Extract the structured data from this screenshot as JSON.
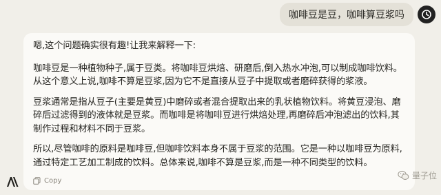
{
  "user_message": "咖啡豆是豆，咖啡算豆浆吗",
  "response": {
    "intro": "嗯,这个问题确实很有趣!让我来解释一下:",
    "paragraphs": [
      "咖啡豆是一种植物种子,属于豆类。将咖啡豆烘焙、研磨后,倒入热水冲泡,可以制成咖啡饮料。从这个意义上说,咖啡不算是豆浆,因为它不是直接从豆子中提取或者磨碎获得的浆液。",
      "豆浆通常是指从豆子(主要是黄豆)中磨碎或者混合提取出来的乳状植物饮料。将黄豆浸泡、磨碎后过滤得到的液体就是豆浆。而咖啡是将咖啡豆进行烘焙处理,再磨碎后冲泡滤出的饮料,其制作过程和材料不同于豆浆。",
      "所以,尽管咖啡的原料是咖啡豆,但咖啡饮料本身不属于豆浆的范围。它是一种以咖啡豆为原料,通过特定工艺加工制成的饮料。总体来说,咖啡不算是豆浆,而是一种不同类型的饮料。"
    ]
  },
  "actions": {
    "copy_label": "Copy"
  },
  "watermark": "量子位",
  "icons": {
    "avatar": "clock-avatar-icon",
    "copy": "copy-icon",
    "logo": "anthropic-logo-icon",
    "watermark": "wechat-icon"
  },
  "colors": {
    "background": "#f1efe9",
    "card": "#fbfaf7",
    "user_bubble": "#e4e1d8",
    "text": "#262521",
    "muted": "#8b877e"
  }
}
